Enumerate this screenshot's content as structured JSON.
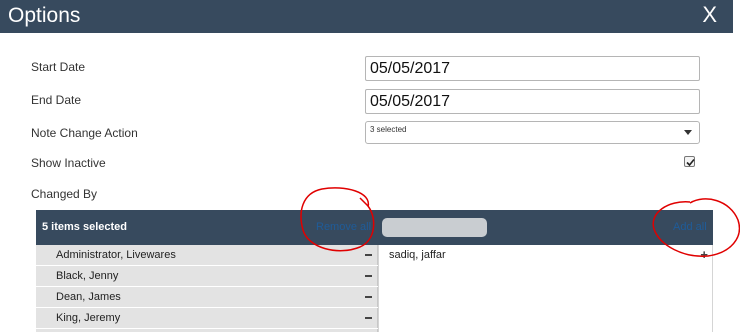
{
  "dialog": {
    "title": "Options",
    "close_label": "X"
  },
  "form": {
    "start_date": {
      "label": "Start Date",
      "value": "05/05/2017"
    },
    "end_date": {
      "label": "End Date",
      "value": "05/05/2017"
    },
    "note_change_action": {
      "label": "Note Change Action",
      "selected_text": "3 selected"
    },
    "show_inactive": {
      "label": "Show Inactive",
      "checked": true
    },
    "changed_by": {
      "label": "Changed By"
    }
  },
  "multiselect": {
    "count_text": "5 items selected",
    "remove_all_label": "Remove all",
    "add_all_label": "Add all",
    "selected_items": [
      "Administrator, Livewares",
      "Black, Jenny",
      "Dean, James",
      "King, Jeremy"
    ],
    "available_items": [
      "sadiq, jaffar"
    ],
    "remove_symbol": "−",
    "add_symbol": "+"
  },
  "colors": {
    "header_bg": "#374a5e",
    "link": "#1f5c99",
    "annotation_red": "#e00000"
  },
  "icons": {
    "close": "close-icon",
    "checkbox_check": "checkmark-icon",
    "select_arrow": "chevron-down-icon"
  }
}
